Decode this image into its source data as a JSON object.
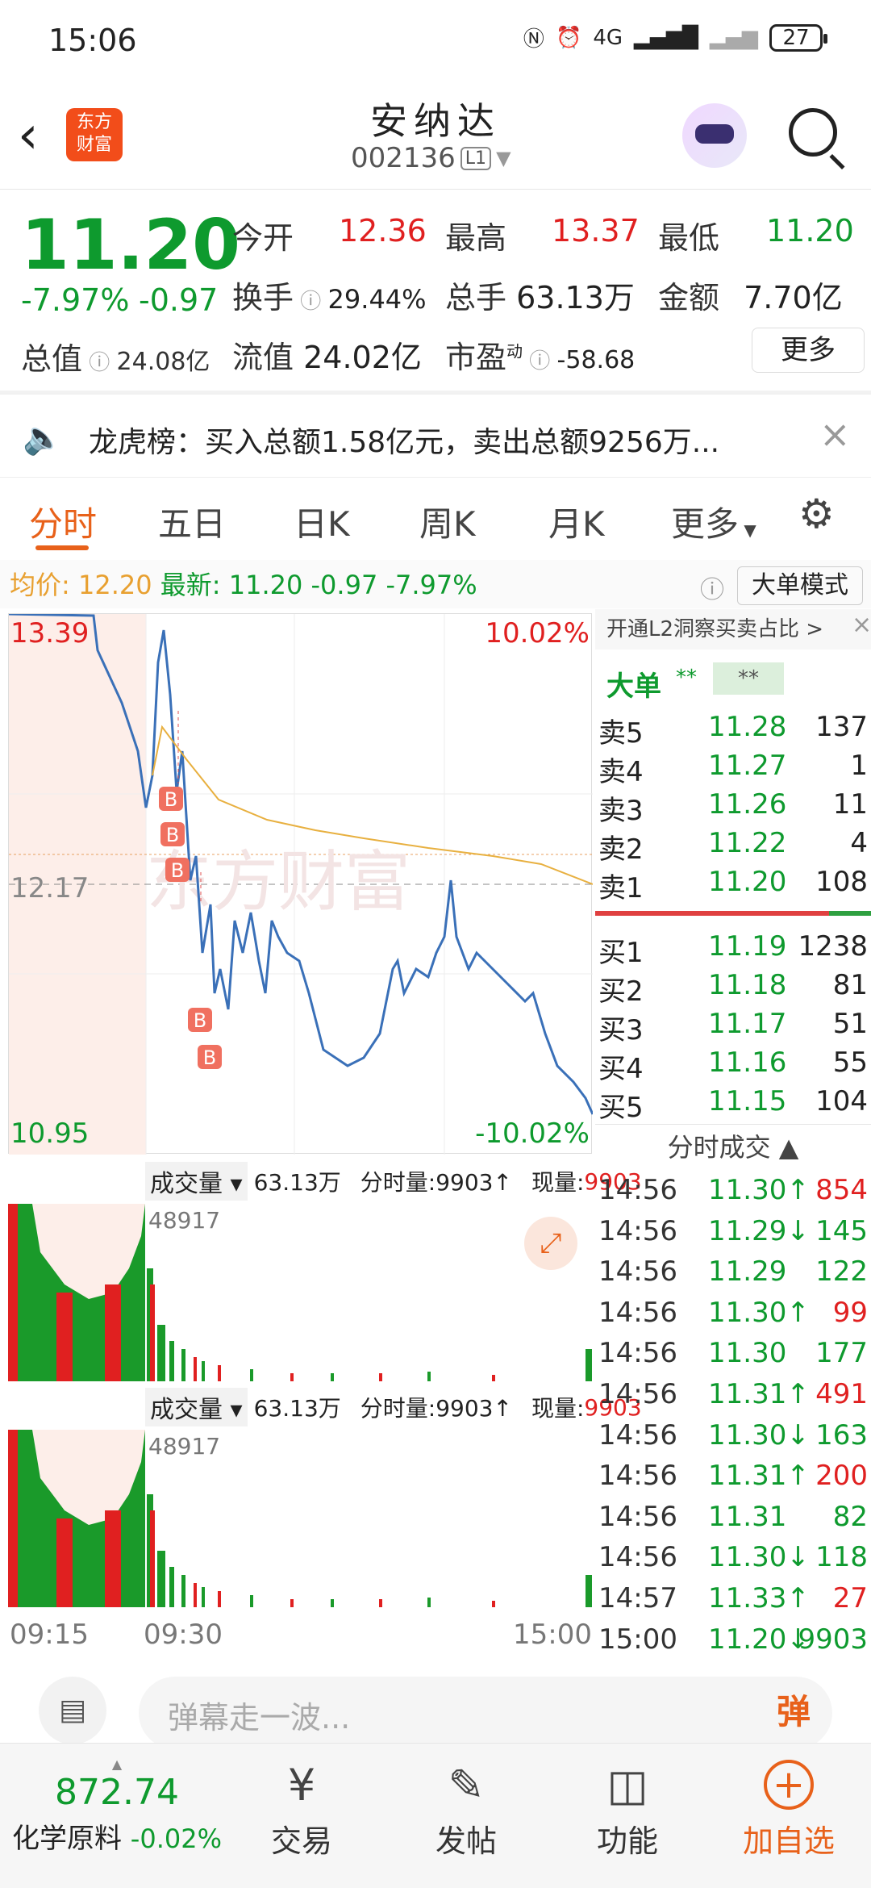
{
  "status_bar": {
    "time": "15:06",
    "network": "4G",
    "battery": "27"
  },
  "header": {
    "title": "安纳达",
    "code": "002136",
    "level": "L1",
    "logo_text_1": "东方",
    "logo_text_2": "财富"
  },
  "quote": {
    "price": "11.20",
    "change_pct": "-7.97%",
    "change": "-0.97",
    "open_label": "今开",
    "open": "12.36",
    "high_label": "最高",
    "high": "13.37",
    "low_label": "最低",
    "low": "11.20",
    "turnover_label": "换手",
    "turnover": "29.44%",
    "volume_label": "总手",
    "volume": "63.13万",
    "amount_label": "金额",
    "amount": "7.70亿",
    "mktcap_label": "总值",
    "mktcap": "24.08亿",
    "float_label": "流值",
    "float": "24.02亿",
    "pe_label": "市盈",
    "pe_sup": "动",
    "pe": "-58.68",
    "more_button": "更多"
  },
  "banner": {
    "text": "龙虎榜：买入总额1.58亿元，卖出总额9256万..."
  },
  "tabs": [
    "分时",
    "五日",
    "日K",
    "周K",
    "月K",
    "更多"
  ],
  "legend": {
    "avg_label": "均价:",
    "avg": "12.20",
    "latest_label": "最新:",
    "latest": "11.20",
    "chg": "-0.97",
    "pct": "-7.97%",
    "mode_button": "大单模式"
  },
  "chart": {
    "y_top": "13.39",
    "y_mid": "12.17",
    "y_bot": "10.95",
    "pct_top": "10.02%",
    "pct_bot": "-10.02%",
    "watermark": "东方财富",
    "buy_marker": "B",
    "time_start": "09:15",
    "time_mid": "09:30",
    "time_end": "15:00"
  },
  "volume_panel": {
    "label": "成交量",
    "total": "63.13万",
    "per_min": "分时量:9903↑",
    "now_label": "现量:",
    "now": "9903",
    "peak": "48917"
  },
  "orderbook": {
    "promo": "开通L2洞察买卖占比 >",
    "big_label": "大单",
    "big_value_1": "**",
    "big_value_2": "**",
    "asks": [
      {
        "label": "卖5",
        "price": "11.28",
        "vol": "137"
      },
      {
        "label": "卖4",
        "price": "11.27",
        "vol": "1"
      },
      {
        "label": "卖3",
        "price": "11.26",
        "vol": "11"
      },
      {
        "label": "卖2",
        "price": "11.22",
        "vol": "4"
      },
      {
        "label": "卖1",
        "price": "11.20",
        "vol": "108"
      }
    ],
    "bids": [
      {
        "label": "买1",
        "price": "11.19",
        "vol": "1238"
      },
      {
        "label": "买2",
        "price": "11.18",
        "vol": "81"
      },
      {
        "label": "买3",
        "price": "11.17",
        "vol": "51"
      },
      {
        "label": "买4",
        "price": "11.16",
        "vol": "55"
      },
      {
        "label": "买5",
        "price": "11.15",
        "vol": "104"
      }
    ],
    "trades_title": "分时成交"
  },
  "trades": [
    {
      "time": "14:56",
      "price": "11.30↑",
      "vol": "854",
      "dir": "up"
    },
    {
      "time": "14:56",
      "price": "11.29↓",
      "vol": "145",
      "dir": "down"
    },
    {
      "time": "14:56",
      "price": "11.29",
      "vol": "122",
      "dir": "down"
    },
    {
      "time": "14:56",
      "price": "11.30↑",
      "vol": "99",
      "dir": "up"
    },
    {
      "time": "14:56",
      "price": "11.30",
      "vol": "177",
      "dir": "down"
    },
    {
      "time": "14:56",
      "price": "11.31↑",
      "vol": "491",
      "dir": "up"
    },
    {
      "time": "14:56",
      "price": "11.30↓",
      "vol": "163",
      "dir": "down"
    },
    {
      "time": "14:56",
      "price": "11.31↑",
      "vol": "200",
      "dir": "up"
    },
    {
      "time": "14:56",
      "price": "11.31",
      "vol": "82",
      "dir": "down"
    },
    {
      "time": "14:56",
      "price": "11.30↓",
      "vol": "118",
      "dir": "down"
    },
    {
      "time": "14:57",
      "price": "11.33↑",
      "vol": "27",
      "dir": "up"
    },
    {
      "time": "15:00",
      "price": "11.20↓",
      "vol": "9903",
      "dir": "down"
    }
  ],
  "comment": {
    "placeholder": "弹幕走一波...",
    "danmu_button": "弹"
  },
  "bottom_nav": {
    "index_value": "872.74",
    "index_name": "化学原料",
    "index_pct": "-0.02%",
    "trade": "交易",
    "post": "发帖",
    "function": "功能",
    "add": "加自选"
  },
  "colors": {
    "accent": "#e8611a",
    "up": "#e02020",
    "down": "#0e9a2e",
    "line": "#3a70b8",
    "avg": "#e8b040"
  }
}
